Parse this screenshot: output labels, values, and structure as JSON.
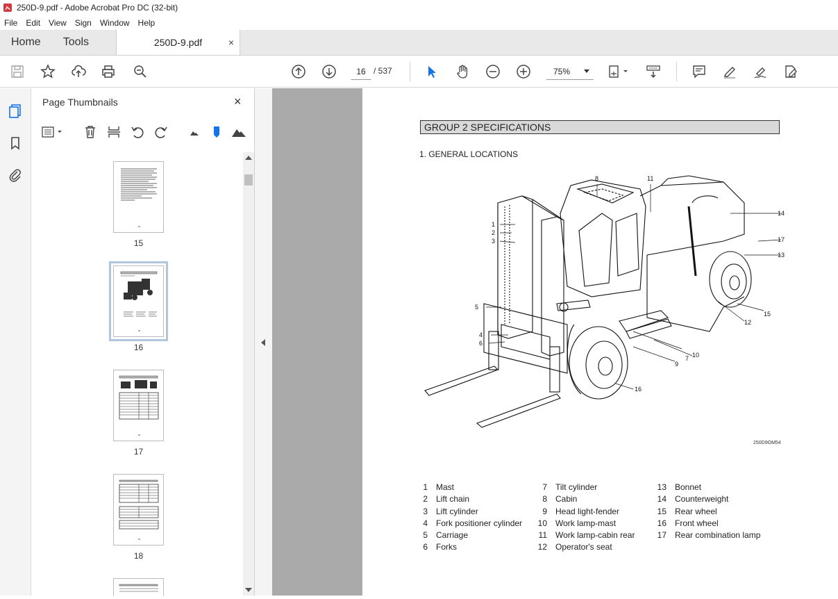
{
  "window": {
    "title": "250D-9.pdf - Adobe Acrobat Pro DC (32-bit)"
  },
  "menu": {
    "items": [
      "File",
      "Edit",
      "View",
      "Sign",
      "Window",
      "Help"
    ]
  },
  "tabs": {
    "home": "Home",
    "tools": "Tools",
    "doc": "250D-9.pdf",
    "doc_close": "×"
  },
  "toolbar": {
    "current_page": "16",
    "total_pages": "/ 537",
    "zoom": "75%"
  },
  "thumbnail_panel": {
    "title": "Page Thumbnails",
    "close": "×",
    "pages": [
      "15",
      "16",
      "17",
      "18"
    ]
  },
  "document": {
    "group_header": "GROUP 2  SPECIFICATIONS",
    "section_title": "1. GENERAL LOCATIONS",
    "figure_code": "250D9OM54",
    "callouts": [
      "1",
      "2",
      "3",
      "4",
      "5",
      "6",
      "7",
      "8",
      "9",
      "10",
      "11",
      "12",
      "13",
      "14",
      "15",
      "16",
      "17"
    ],
    "legend": [
      [
        {
          "n": "1",
          "label": "Mast"
        },
        {
          "n": "2",
          "label": "Lift chain"
        },
        {
          "n": "3",
          "label": "Lift cylinder"
        },
        {
          "n": "4",
          "label": "Fork positioner cylinder"
        },
        {
          "n": "5",
          "label": "Carriage"
        },
        {
          "n": "6",
          "label": "Forks"
        }
      ],
      [
        {
          "n": "7",
          "label": "Tilt cylinder"
        },
        {
          "n": "8",
          "label": "Cabin"
        },
        {
          "n": "9",
          "label": "Head light-fender"
        },
        {
          "n": "10",
          "label": "Work lamp-mast"
        },
        {
          "n": "11",
          "label": "Work lamp-cabin rear"
        },
        {
          "n": "12",
          "label": "Operator's seat"
        }
      ],
      [
        {
          "n": "13",
          "label": "Bonnet"
        },
        {
          "n": "14",
          "label": "Counterweight"
        },
        {
          "n": "15",
          "label": "Rear wheel"
        },
        {
          "n": "16",
          "label": "Front wheel"
        },
        {
          "n": "17",
          "label": "Rear combination lamp"
        }
      ]
    ]
  },
  "colors": {
    "accent": "#1473e6",
    "doc_bg": "#aaaaaa",
    "header_bg": "#d9d9d9"
  }
}
